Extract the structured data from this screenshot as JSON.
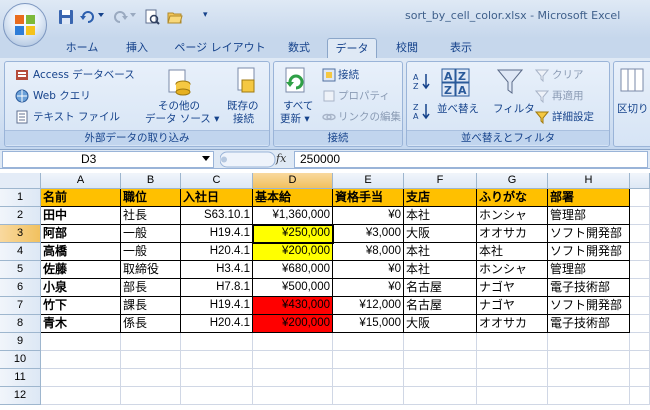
{
  "window": {
    "title": "sort_by_cell_color.xlsx - Microsoft Excel"
  },
  "tabs": [
    {
      "label": "ホーム",
      "active": false
    },
    {
      "label": "挿入",
      "active": false
    },
    {
      "label": "ページ レイアウト",
      "active": false
    },
    {
      "label": "数式",
      "active": false
    },
    {
      "label": "データ",
      "active": true
    },
    {
      "label": "校閲",
      "active": false
    },
    {
      "label": "表示",
      "active": false
    }
  ],
  "ribbon": {
    "external": {
      "label": "外部データの取り込み",
      "access": "Access データベース",
      "web": "Web クエリ",
      "text": "テキスト ファイル",
      "other_line1": "その他の",
      "other_line2": "データ ソース ▾",
      "existing_line1": "既存の",
      "existing_line2": "接続"
    },
    "connections": {
      "label": "接続",
      "refresh_line1": "すべて",
      "refresh_line2": "更新 ▾",
      "connections": "接続",
      "properties": "プロパティ",
      "edit_links": "リンクの編集"
    },
    "sort_filter": {
      "label": "並べ替えとフィルタ",
      "sort": "並べ替え",
      "filter": "フィルタ",
      "clear": "クリア",
      "reapply": "再適用",
      "advanced": "詳細設定"
    },
    "data_tools": {
      "partial": "区切り"
    }
  },
  "formula_bar": {
    "name_box": "D3",
    "fx": "fx",
    "formula": "250000"
  },
  "sheet": {
    "columns": [
      "A",
      "B",
      "C",
      "D",
      "E",
      "F",
      "G",
      "H"
    ],
    "rows": [
      "1",
      "2",
      "3",
      "4",
      "5",
      "6",
      "7",
      "8",
      "9",
      "10",
      "11",
      "12"
    ],
    "header": [
      "名前",
      "職位",
      "入社日",
      "基本給",
      "資格手当",
      "支店",
      "ふりがな",
      "部署"
    ],
    "data": [
      [
        "田中",
        "社長",
        "S63.10.1",
        "¥1,360,000",
        "¥0",
        "本社",
        "ホンシャ",
        "管理部"
      ],
      [
        "阿部",
        "一般",
        "H19.4.1",
        "¥250,000",
        "¥3,000",
        "大阪",
        "オオサカ",
        "ソフト開発部"
      ],
      [
        "高橋",
        "一般",
        "H20.4.1",
        "¥200,000",
        "¥8,000",
        "本社",
        "本社",
        "ソフト開発部"
      ],
      [
        "佐藤",
        "取締役",
        "H3.4.1",
        "¥680,000",
        "¥0",
        "本社",
        "ホンシャ",
        "管理部"
      ],
      [
        "小泉",
        "部長",
        "H7.8.1",
        "¥500,000",
        "¥0",
        "名古屋",
        "ナゴヤ",
        "電子技術部"
      ],
      [
        "竹下",
        "課長",
        "H19.4.1",
        "¥430,000",
        "¥12,000",
        "名古屋",
        "ナゴヤ",
        "ソフト開発部"
      ],
      [
        "青木",
        "係長",
        "H20.4.1",
        "¥200,000",
        "¥15,000",
        "大阪",
        "オオサカ",
        "電子技術部"
      ]
    ],
    "salary_fill": [
      "none",
      "yellow",
      "yellow",
      "none",
      "none",
      "red",
      "red"
    ],
    "colors": {
      "header_fill": "#ffc000",
      "yellow": "#ffff00",
      "red": "#ff0000"
    }
  }
}
